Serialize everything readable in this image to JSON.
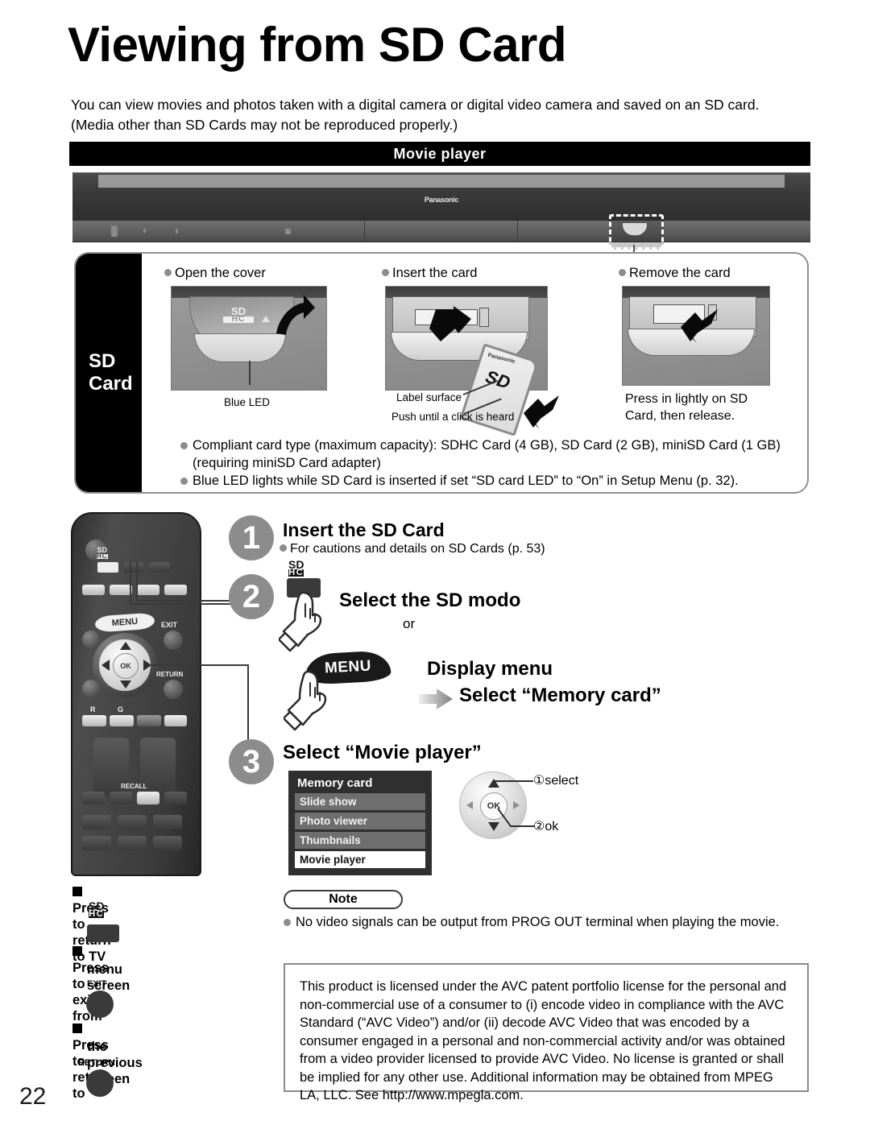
{
  "page": {
    "title": "Viewing from SD Card",
    "intro": "You can view movies and photos taken with a digital camera or digital video camera and saved on an SD card. (Media other than SD Cards may not be reproduced properly.)",
    "band_label": "Movie player",
    "page_number": "22"
  },
  "tv": {
    "brand": "Panasonic",
    "slot_name": "sd-card-slot"
  },
  "sd_panel": {
    "tab_line1": "SD",
    "tab_line2": "Card",
    "columns": [
      {
        "heading": "Open the cover",
        "captions": [
          "Blue LED"
        ],
        "mark": "SD",
        "mark_sub": "HC"
      },
      {
        "heading": "Insert the card",
        "captions": [
          "Label surface",
          "Push until a click is heard"
        ],
        "card_brand": "Panasonic",
        "card_logo": "SD"
      },
      {
        "heading": "Remove the card",
        "captions": [
          "Press in lightly on SD",
          "Card, then release."
        ]
      }
    ],
    "notes": [
      "Compliant card type (maximum capacity): SDHC Card (4 GB), SD Card (2 GB), miniSD Card (1 GB) (requiring miniSD Card adapter)",
      "Blue LED lights while SD Card is inserted if set “SD card LED” to “On” in Setup Menu (p. 32)."
    ]
  },
  "remote": {
    "menu_label": "MENU",
    "ok_label": "OK",
    "exit_label": "EXIT",
    "return_label": "RETURN",
    "recall_label": "RECALL",
    "red_label": "R",
    "green_label": "G",
    "sd_icon_top": "SD",
    "sd_icon_bottom": "HC"
  },
  "steps": [
    {
      "number": "1",
      "title": "Insert the SD Card",
      "sub": "For cautions and details on SD Cards (p. 53)"
    },
    {
      "number": "2",
      "title": "Select the SD modo",
      "or": "or",
      "menu_button": "MENU",
      "alt_title": "Display menu",
      "alt_sub": "Select “Memory card”"
    },
    {
      "number": "3",
      "title": "Select “Movie player”"
    }
  ],
  "menu_screen": {
    "title": "Memory card",
    "items": [
      {
        "label": "Slide show",
        "selected": false
      },
      {
        "label": "Photo viewer",
        "selected": false
      },
      {
        "label": "Thumbnails",
        "selected": false
      },
      {
        "label": "Movie player",
        "selected": true
      }
    ]
  },
  "dial": {
    "ok": "OK",
    "label_select": "①select",
    "label_ok": "②ok"
  },
  "legend": [
    {
      "text": "Press to return to TV",
      "key": "sd"
    },
    {
      "text_line1": "Press to exit from",
      "text_line2": "menu screen",
      "key": "EXIT"
    },
    {
      "text_line1": "Press to return to",
      "text_line2": "the previous screen",
      "key": "RETURN"
    }
  ],
  "note": {
    "pill": "Note",
    "body": "No video signals can be output from PROG OUT terminal when playing the movie."
  },
  "legal": {
    "body": "This product is licensed under the AVC patent portfolio license for the personal and non-commercial use of a consumer to (i) encode video in compliance with the AVC Standard (“AVC Video”) and/or (ii) decode AVC Video that was encoded by a consumer engaged in a personal and non-commercial activity and/or was obtained from a video provider licensed to provide AVC Video. No license is granted or shall be implied for any other use. Additional information may be obtained from MPEG LA, LLC. See http://www.mpegla.com."
  },
  "colors": {
    "accent_gray": "#8c8c8c",
    "panel_border": "#909090",
    "black": "#000000"
  }
}
